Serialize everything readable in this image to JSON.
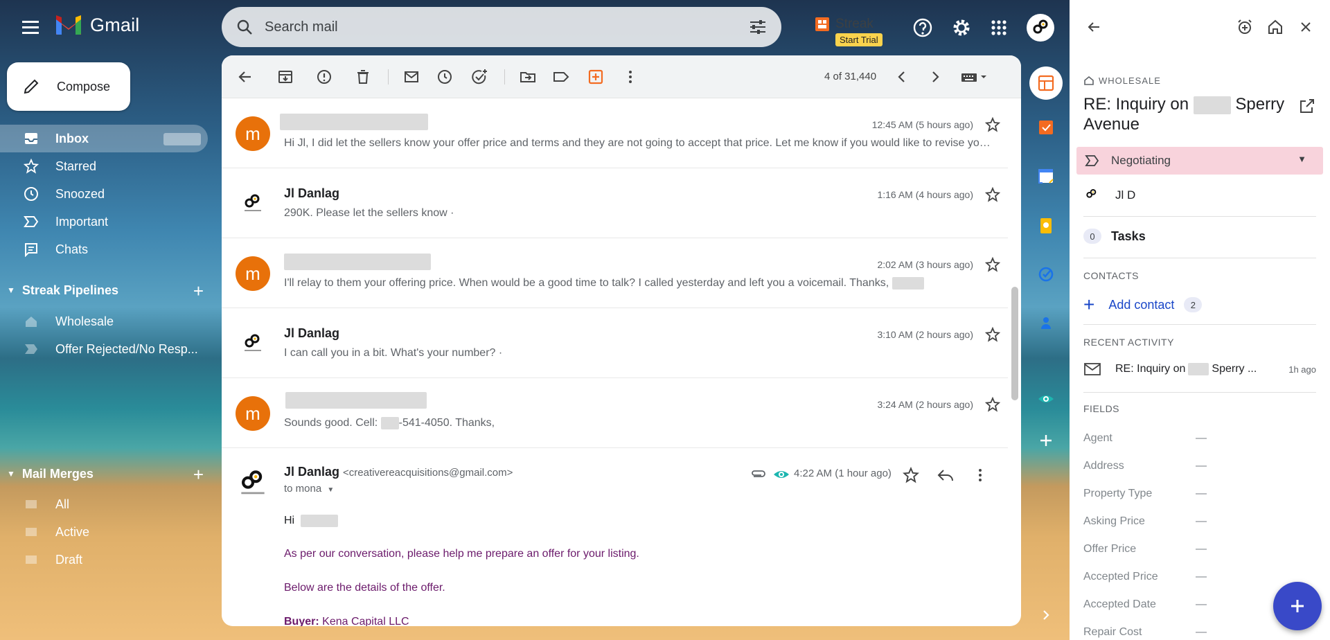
{
  "app": {
    "name": "Gmail"
  },
  "search": {
    "placeholder": "Search mail"
  },
  "streak": {
    "label": "Streak",
    "trial": "Start Trial"
  },
  "compose": {
    "label": "Compose"
  },
  "nav": [
    {
      "id": "inbox",
      "label": "Inbox"
    },
    {
      "id": "starred",
      "label": "Starred"
    },
    {
      "id": "snoozed",
      "label": "Snoozed"
    },
    {
      "id": "important",
      "label": "Important"
    },
    {
      "id": "chats",
      "label": "Chats"
    }
  ],
  "streak_pipelines": {
    "title": "Streak Pipelines",
    "items": [
      "Wholesale",
      "Offer Rejected/No Resp..."
    ]
  },
  "mail_merges": {
    "title": "Mail Merges",
    "items": [
      "All",
      "Active",
      "Draft"
    ]
  },
  "toolbar": {
    "pager": "4 of 31,440"
  },
  "messages": [
    {
      "sender": "",
      "avatar": "m",
      "snippet": "Hi Jl, I did let the sellers know your offer price and terms and they are not going to accept that price. Let me know if you would like to revise your offer.",
      "time": "12:45 AM (5 hours ago)"
    },
    {
      "sender": "Jl Danlag",
      "avatar": "creative",
      "snippet": "290K. Please let the sellers know ·",
      "time": "1:16 AM (4 hours ago)"
    },
    {
      "sender": "",
      "avatar": "m",
      "snippet": "I'll relay to them your offering price. When would be a good time to talk? I called yesterday and left you a voicemail. Thanks,",
      "time": "2:02 AM (3 hours ago)"
    },
    {
      "sender": "Jl Danlag",
      "avatar": "creative",
      "snippet": "I can call you in a bit. What's your number? ·",
      "time": "3:10 AM (2 hours ago)"
    },
    {
      "sender": "",
      "avatar": "m",
      "snippet_pre": "Sounds good. Cell: ",
      "snippet_post": "-541-4050. Thanks,",
      "time": "3:24 AM (2 hours ago)"
    }
  ],
  "open_message": {
    "sender": "Jl Danlag",
    "email": "<creativereacquisitions@gmail.com>",
    "to": "to mona",
    "time": "4:22 AM (1 hour ago)",
    "greeting": "Hi",
    "line1": "As per our conversation, please help me prepare an offer for your listing.",
    "line2": "Below are the details of the offer.",
    "buyer_label": "Buyer:",
    "buyer_value": "Kena Capital LLC"
  },
  "panel": {
    "breadcrumb": "WHOLESALE",
    "title_pre": "RE: Inquiry on",
    "title_post": "Sperry Avenue",
    "stage": "Negotiating",
    "owner": "Jl D",
    "tasks_count": "0",
    "tasks_label": "Tasks",
    "contacts_head": "CONTACTS",
    "add_contact": "Add contact",
    "contacts_count": "2",
    "activity_head": "RECENT ACTIVITY",
    "activity_pre": "RE: Inquiry on",
    "activity_post": "Sperry ...",
    "activity_age": "1h ago",
    "fields_head": "FIELDS",
    "fields": [
      "Agent",
      "Address",
      "Property Type",
      "Asking Price",
      "Offer Price",
      "Accepted Price",
      "Accepted Date",
      "Repair Cost"
    ],
    "field_empty": "—"
  },
  "colors": {
    "accent": "#3949c8",
    "stage_bg": "#f8d3dc",
    "avatar_m": "#e8710a",
    "body_text": "#6b1a6b"
  }
}
